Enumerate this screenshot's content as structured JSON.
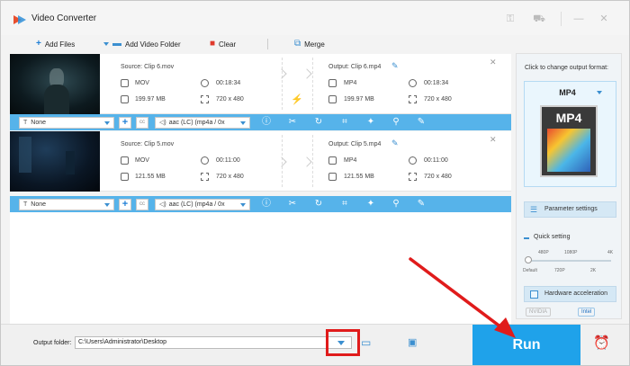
{
  "app": {
    "title": "Video Converter"
  },
  "toolbar": {
    "add_files": "Add Files",
    "add_video_folder": "Add Video Folder",
    "clear": "Clear",
    "merge": "Merge"
  },
  "files": [
    {
      "source": "Source: Clip 6.mov",
      "src_format": "MOV",
      "src_duration": "00:18:34",
      "src_size": "199.97 MB",
      "src_resolution": "720 x 480",
      "output": "Output: Clip 6.mp4",
      "out_format": "MP4",
      "out_duration": "00:18:34",
      "out_size": "199.97 MB",
      "out_resolution": "720 x 480",
      "subtitle": "None",
      "audio": "aac (LC) (mp4a / 0x"
    },
    {
      "source": "Source: Clip 5.mov",
      "src_format": "MOV",
      "src_duration": "00:11:00",
      "src_size": "121.55 MB",
      "src_resolution": "720 x 480",
      "output": "Output: Clip 5.mp4",
      "out_format": "MP4",
      "out_duration": "00:11:00",
      "out_size": "121.55 MB",
      "out_resolution": "720 x 480",
      "subtitle": "None",
      "audio": "aac (LC) (mp4a / 0x"
    }
  ],
  "right_panel": {
    "click_to_change": "Click to change output format:",
    "format": "MP4",
    "format_icon_text": "MP4",
    "parameter_settings": "Parameter settings",
    "quick_setting": "Quick setting",
    "quality_top": [
      "480P",
      "1080P",
      "4K"
    ],
    "quality_bottom": [
      "Default",
      "720P",
      "2K"
    ],
    "hardware_acceleration": "Hardware acceleration",
    "nvidia": "NVIDIA",
    "intel": "Intel"
  },
  "bottom": {
    "output_folder_label": "Output folder:",
    "output_folder_value": "C:\\Users\\Administrator\\Desktop",
    "run": "Run"
  },
  "colors": {
    "accent": "#1fa2ea",
    "edit_bar": "#56b3ea",
    "annotation": "#e01b1b"
  }
}
